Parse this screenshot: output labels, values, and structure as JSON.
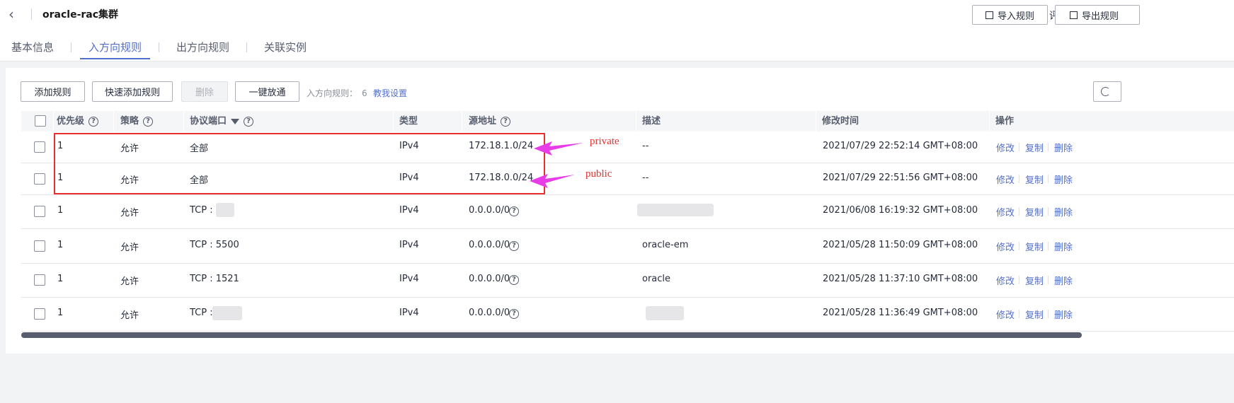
{
  "header": {
    "title": "oracle-rac集群",
    "eval_label": "评价",
    "import_label": "导入规则",
    "export_label": "导出规则"
  },
  "tabs": [
    {
      "label": "基本信息",
      "active": false
    },
    {
      "label": "入方向规则",
      "active": true
    },
    {
      "label": "出方向规则",
      "active": false
    },
    {
      "label": "关联实例",
      "active": false
    }
  ],
  "toolbar": {
    "add_rule": "添加规则",
    "quick_add": "快速添加规则",
    "delete": "删除",
    "one_click": "一键放通",
    "count_label": "入方向规则：",
    "count_value": "6",
    "help_link": "教我设置"
  },
  "table": {
    "headers": [
      "优先级",
      "策略",
      "协议端口",
      "类型",
      "源地址",
      "描述",
      "修改时间",
      "操作"
    ],
    "rows": [
      {
        "priority": "1",
        "policy": "允许",
        "port": "全部",
        "type": "IPv4",
        "source": "172.18.1.0/24",
        "desc": "--",
        "time": "2021/07/29 22:52:14 GMT+08:00"
      },
      {
        "priority": "1",
        "policy": "允许",
        "port": "全部",
        "type": "IPv4",
        "source": "172.18.0.0/24",
        "desc": "--",
        "time": "2021/07/29 22:51:56 GMT+08:00"
      },
      {
        "priority": "1",
        "policy": "允许",
        "port": "TCP :",
        "type": "IPv4",
        "source": "0.0.0.0/0",
        "desc": "",
        "time": "2021/06/08 16:19:32 GMT+08:00"
      },
      {
        "priority": "1",
        "policy": "允许",
        "port": "TCP : 5500",
        "type": "IPv4",
        "source": "0.0.0.0/0",
        "desc": "oracle-em",
        "time": "2021/05/28 11:50:09 GMT+08:00"
      },
      {
        "priority": "1",
        "policy": "允许",
        "port": "TCP : 1521",
        "type": "IPv4",
        "source": "0.0.0.0/0",
        "desc": "oracle",
        "time": "2021/05/28 11:37:10 GMT+08:00"
      },
      {
        "priority": "1",
        "policy": "允许",
        "port": "TCP : 1",
        "type": "IPv4",
        "source": "0.0.0.0/0",
        "desc": "",
        "time": "2021/05/28 11:36:49 GMT+08:00"
      }
    ],
    "actions": {
      "edit": "修改",
      "copy": "复制",
      "delete": "删除"
    }
  },
  "annotations": {
    "private": "private",
    "public": "public",
    "color": "#e8312f",
    "arrow_color": "#e83ce8"
  },
  "colors": {
    "accent": "#526ecc",
    "text": "#252b3a"
  }
}
